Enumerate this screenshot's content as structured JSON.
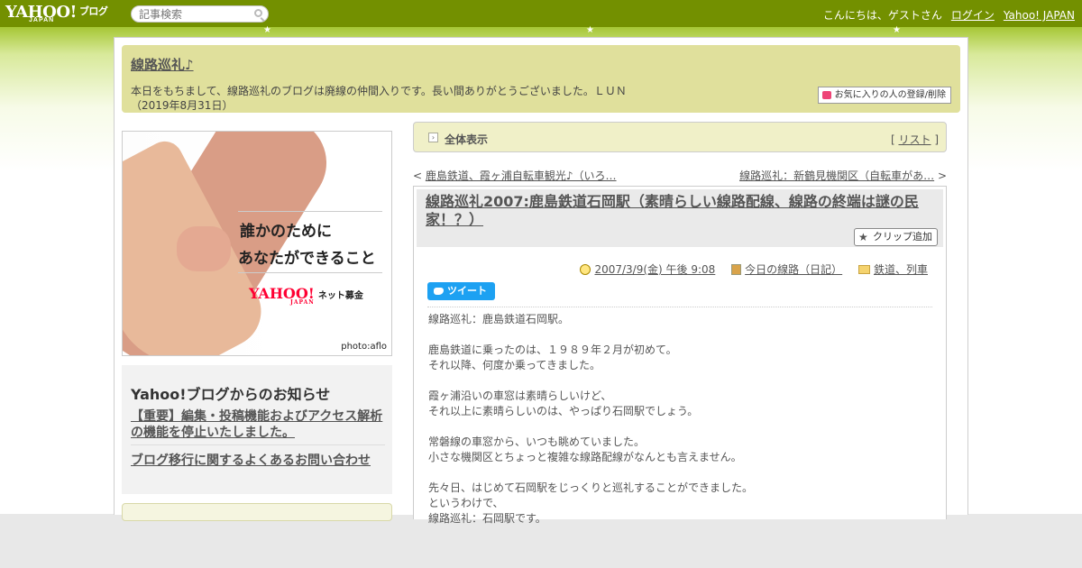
{
  "topbar": {
    "logo": "YAHOO!",
    "logo_sub": "JAPAN",
    "logo_blog": "ブログ",
    "search_placeholder": "記事検索",
    "greeting": "こんにちは、ゲストさん",
    "login": "ログイン",
    "yahoo_japan": "Yahoo! JAPAN"
  },
  "blog": {
    "title": "線路巡礼♪",
    "description_line1": "本日をもちまして、線路巡礼のブログは廃線の仲間入りです。長い間ありがとうございました。ＬＵＮ",
    "description_line2": "（2019年8月31日）",
    "favorite_button": "お気に入りの人の登録/削除"
  },
  "ad": {
    "line1": "誰かのために",
    "line2": "あなたができること",
    "brand": "YAHOO!",
    "brand_sub": "JAPAN",
    "brand_service": "ネット募金",
    "credit": "photo:aflo"
  },
  "notice": {
    "heading": "Yahoo!ブログからのお知らせ",
    "item1": "【重要】編集・投稿機能およびアクセス解析の機能を停止いたしました。",
    "item2": "ブログ移行に関するよくあるお問い合わせ"
  },
  "tabbar": {
    "label": "全体表示",
    "list_prefix": "[ ",
    "list": "リスト",
    "list_suffix": " ]"
  },
  "nav": {
    "prev_arrow": "< ",
    "prev": "鹿島鉄道、霞ヶ浦自転車観光♪（いろ…",
    "next": "線路巡礼：新鶴見機関区（自転車があ…",
    "next_arrow": " >"
  },
  "article": {
    "title": "線路巡礼2007:鹿島鉄道石岡駅（素晴らしい線路配線、線路の終端は謎の民家！？）",
    "clip": "クリップ追加",
    "date": "2007/3/9(金) 午後 9:08",
    "category1": "今日の線路（日記）",
    "category2": "鉄道、列車",
    "tweet": "ツイート",
    "body": "線路巡礼：鹿島鉄道石岡駅。\n\n鹿島鉄道に乗ったのは、１９８９年２月が初めて。\nそれ以降、何度か乗ってきました。\n\n霞ヶ浦沿いの車窓は素晴らしいけど、\nそれ以上に素晴らしいのは、やっぱり石岡駅でしょう。\n\n常磐線の車窓から、いつも眺めていました。\n小さな機関区とちょっと複雑な線路配線がなんとも言えません。\n\n先々日、はじめて石岡駅をじっくりと巡礼することができました。\nというわけで、\n線路巡礼：石岡駅です。"
  },
  "colors": {
    "topbar": "#739000",
    "header_bg": "#e0e09c",
    "tweet": "#1da1f2"
  },
  "icons": [
    "search-icon",
    "heart-icon",
    "star-icon",
    "clock-icon",
    "book-icon",
    "folder-icon",
    "twitter-bird-icon",
    "arrow-right-icon"
  ]
}
